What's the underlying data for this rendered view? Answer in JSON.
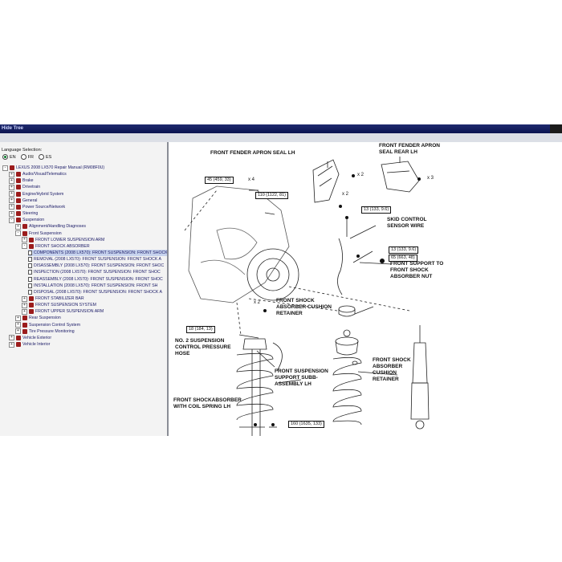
{
  "window": {
    "title": "Hide Tree"
  },
  "language": {
    "title": "Language Selection:",
    "options": [
      "EN",
      "FR",
      "ES"
    ],
    "selected": "EN"
  },
  "tree": [
    {
      "label": "LEXUS 2008 LX570 Repair Manual (RM08F0U)",
      "level": 0,
      "icon": "book",
      "toggle": "-"
    },
    {
      "label": "Audio/Visual/Telematics",
      "level": 1,
      "icon": "book",
      "toggle": "+"
    },
    {
      "label": "Brake",
      "level": 1,
      "icon": "book",
      "toggle": "+"
    },
    {
      "label": "Drivetrain",
      "level": 1,
      "icon": "book",
      "toggle": "+"
    },
    {
      "label": "Engine/Hybrid System",
      "level": 1,
      "icon": "book",
      "toggle": "+"
    },
    {
      "label": "General",
      "level": 1,
      "icon": "book",
      "toggle": "+"
    },
    {
      "label": "Power Source/Network",
      "level": 1,
      "icon": "book",
      "toggle": "+"
    },
    {
      "label": "Steering",
      "level": 1,
      "icon": "book",
      "toggle": "+"
    },
    {
      "label": "Suspension",
      "level": 1,
      "icon": "book",
      "toggle": "-"
    },
    {
      "label": "Alignment/Handling Diagnoses",
      "level": 2,
      "icon": "book",
      "toggle": "+"
    },
    {
      "label": "Front Suspension",
      "level": 2,
      "icon": "book",
      "toggle": "-"
    },
    {
      "label": "FRONT LOWER SUSPENSION ARM",
      "level": 3,
      "icon": "book",
      "toggle": "+"
    },
    {
      "label": "FRONT SHOCK ABSORBER",
      "level": 3,
      "icon": "book",
      "toggle": "-"
    },
    {
      "label": "COMPONENTS (2008 LX570): FRONT SUSPENSION: FRONT SHOCK",
      "level": 4,
      "icon": "doc",
      "toggle": "",
      "selected": true
    },
    {
      "label": "REMOVAL (2008 LX570): FRONT SUSPENSION: FRONT SHOCK A",
      "level": 4,
      "icon": "doc",
      "toggle": ""
    },
    {
      "label": "DISASSEMBLY (2008 LX570): FRONT SUSPENSION: FRONT SHOC",
      "level": 4,
      "icon": "doc",
      "toggle": ""
    },
    {
      "label": "INSPECTION (2008 LX570): FRONT SUSPENSION: FRONT SHOC",
      "level": 4,
      "icon": "doc",
      "toggle": ""
    },
    {
      "label": "REASSEMBLY (2008 LX570): FRONT SUSPENSION: FRONT SHOC",
      "level": 4,
      "icon": "doc",
      "toggle": ""
    },
    {
      "label": "INSTALLATION (2008 LX570): FRONT SUSPENSION: FRONT SH",
      "level": 4,
      "icon": "doc",
      "toggle": ""
    },
    {
      "label": "DISPOSAL (2008 LX570): FRONT SUSPENSION: FRONT SHOCK A",
      "level": 4,
      "icon": "doc",
      "toggle": ""
    },
    {
      "label": "FRONT STABILIZER BAR",
      "level": 3,
      "icon": "book",
      "toggle": "+"
    },
    {
      "label": "FRONT SUSPENSION SYSTEM",
      "level": 3,
      "icon": "book",
      "toggle": "+"
    },
    {
      "label": "FRONT UPPER SUSPENSION ARM",
      "level": 3,
      "icon": "book",
      "toggle": "+"
    },
    {
      "label": "Rear Suspension",
      "level": 2,
      "icon": "book",
      "toggle": "+"
    },
    {
      "label": "Suspension Control System",
      "level": 2,
      "icon": "book",
      "toggle": "+"
    },
    {
      "label": "Tire Pressure Monitoring",
      "level": 2,
      "icon": "book",
      "toggle": "+"
    },
    {
      "label": "Vehicle Exterior",
      "level": 1,
      "icon": "book",
      "toggle": "+"
    },
    {
      "label": "Vehicle Interior",
      "level": 1,
      "icon": "book",
      "toggle": "+"
    }
  ],
  "diagram": {
    "labels": {
      "fender_seal_lh": "FRONT FENDER APRON SEAL LH",
      "fender_seal_rear_lh": "FRONT FENDER APRON\nSEAL REAR LH",
      "skid_sensor": "SKID CONTROL\nSENSOR WIRE",
      "support_nut": "FRONT SUPPORT TO\nFRONT SHOCK\nABSORBER NUT",
      "cushion_retainer": "FRONT SHOCK\nABSORBER CUSHION\nRETAINER",
      "control_hose": "NO. 2 SUSPENSION\nCONTROL PRESSURE\nHOSE",
      "support_subassy": "FRONT SUSPENSION\nSUPPORT SUBB-\nASSEMBLY LH",
      "cushion_retainer_2": "FRONT SHOCK\nABSORBER\nCUSHION\nRETAINER",
      "shock_with_spring": "FRONT SHOCKABSORBER\nWITH COIL SPRING LH"
    },
    "torques": {
      "t1": "45 (459, 33)",
      "t2": "110 (1122, 81)",
      "t3": "13 (133, 9.6)",
      "t4": "13 (133, 9.6)",
      "t5": "65 (663, 48)",
      "t6": "18 (184, 13)",
      "t7": "160 (1635, 133)"
    },
    "multipliers": {
      "m1": "x 4",
      "m2": "x 2",
      "m3": "x 3",
      "m4": "x 2",
      "m5": "x 2"
    }
  }
}
